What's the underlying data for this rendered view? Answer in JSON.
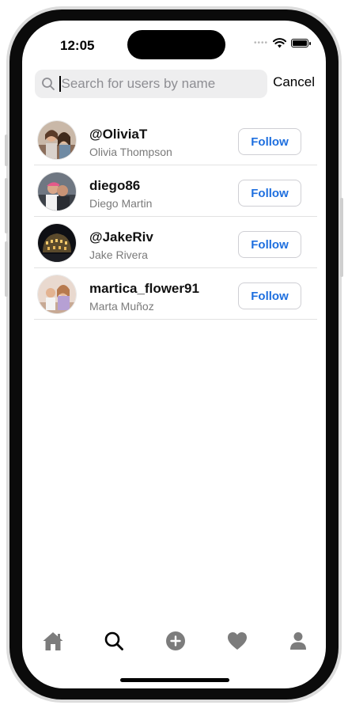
{
  "status_bar": {
    "time": "12:05"
  },
  "search": {
    "placeholder": "Search for users by name",
    "value": "",
    "cancel_label": "Cancel"
  },
  "users": [
    {
      "handle": "@OliviaT",
      "name": "Olivia Thompson",
      "follow_label": "Follow"
    },
    {
      "handle": "diego86",
      "name": "Diego Martin",
      "follow_label": "Follow"
    },
    {
      "handle": "@JakeRiv",
      "name": "Jake Rivera",
      "follow_label": "Follow"
    },
    {
      "handle": "martica_flower91",
      "name": "Marta Muñoz",
      "follow_label": "Follow"
    }
  ],
  "tab_bar": {
    "icons": [
      "home-icon",
      "search-icon",
      "add-icon",
      "heart-icon",
      "profile-icon"
    ],
    "active": "search-icon"
  },
  "colors": {
    "accent": "#1e6fdf",
    "inactive_tab": "#7c7c7c",
    "active_tab": "#000000"
  }
}
